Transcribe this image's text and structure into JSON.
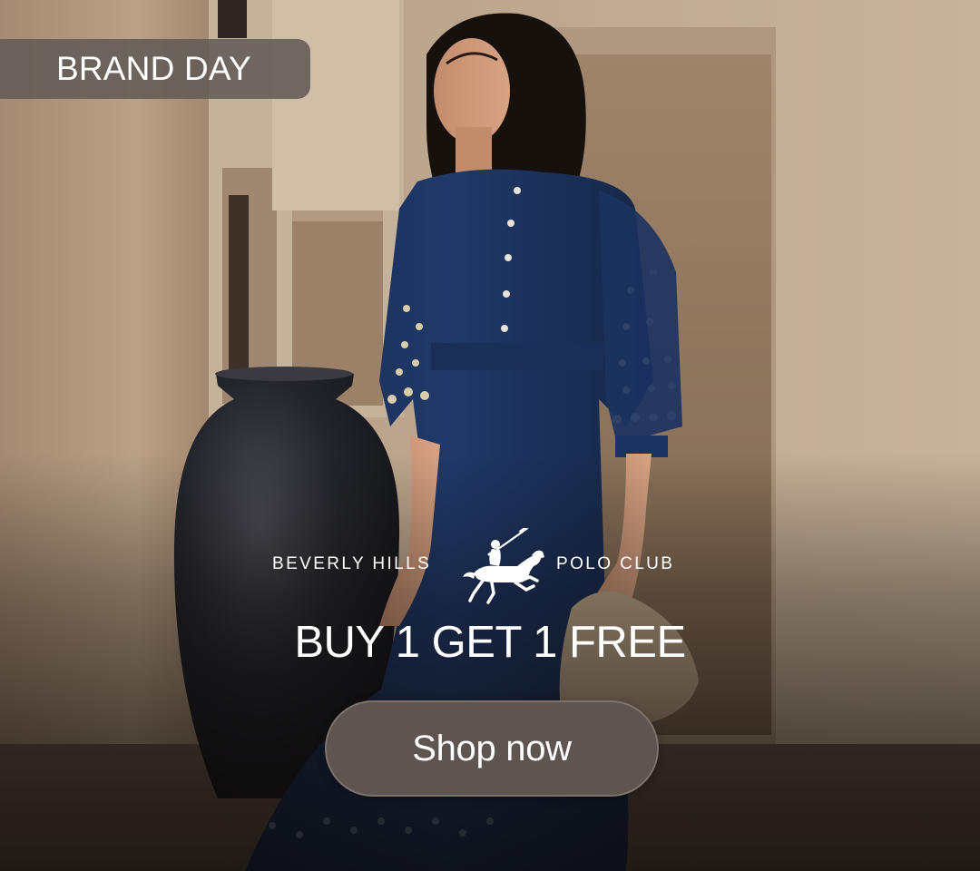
{
  "badge": {
    "label": "BRAND DAY"
  },
  "brand": {
    "name_left": "BEVERLY HILLS",
    "name_right": "POLO CLUB",
    "emblem": "polo-rider-icon"
  },
  "offer": {
    "headline": "BUY 1 GET 1 FREE"
  },
  "cta": {
    "label": "Shop now"
  },
  "colors": {
    "badge_bg": "#625b56",
    "button_bg": "#5e5450",
    "text": "#ffffff",
    "dress": "#1f3560",
    "wall": "#b8a28a"
  }
}
